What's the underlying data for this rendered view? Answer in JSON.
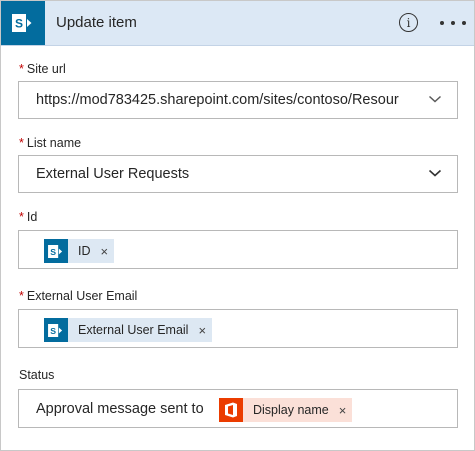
{
  "header": {
    "title": "Update item",
    "app_icon": "sharepoint-icon",
    "info_icon": "info-icon",
    "more_icon": "more-options-icon",
    "bg_color": "#dce8f5",
    "tile_color": "#036c9e"
  },
  "fields": {
    "site_url": {
      "label": "Site url",
      "required": "*",
      "value": "https://mod783425.sharepoint.com/sites/contoso/Resour"
    },
    "list_name": {
      "label": "List name",
      "required": "*",
      "value": "External User Requests"
    },
    "id": {
      "label": "Id",
      "required": "*",
      "token": {
        "label": "ID",
        "remove": "×",
        "icon": "sharepoint-icon"
      }
    },
    "external_user_email": {
      "label": "External User Email",
      "required": "*",
      "token": {
        "label": "External User Email",
        "remove": "×",
        "icon": "sharepoint-icon"
      }
    },
    "status": {
      "label": "Status",
      "prefix_text": "Approval message sent to",
      "token": {
        "label": "Display name",
        "remove": "×",
        "icon": "office365-icon"
      }
    }
  },
  "colors": {
    "required": "#c00000",
    "sharepoint": "#036c9e",
    "office365": "#eb3c00",
    "token_blue": "#dde8f3",
    "token_orange": "#fbe0d8"
  }
}
